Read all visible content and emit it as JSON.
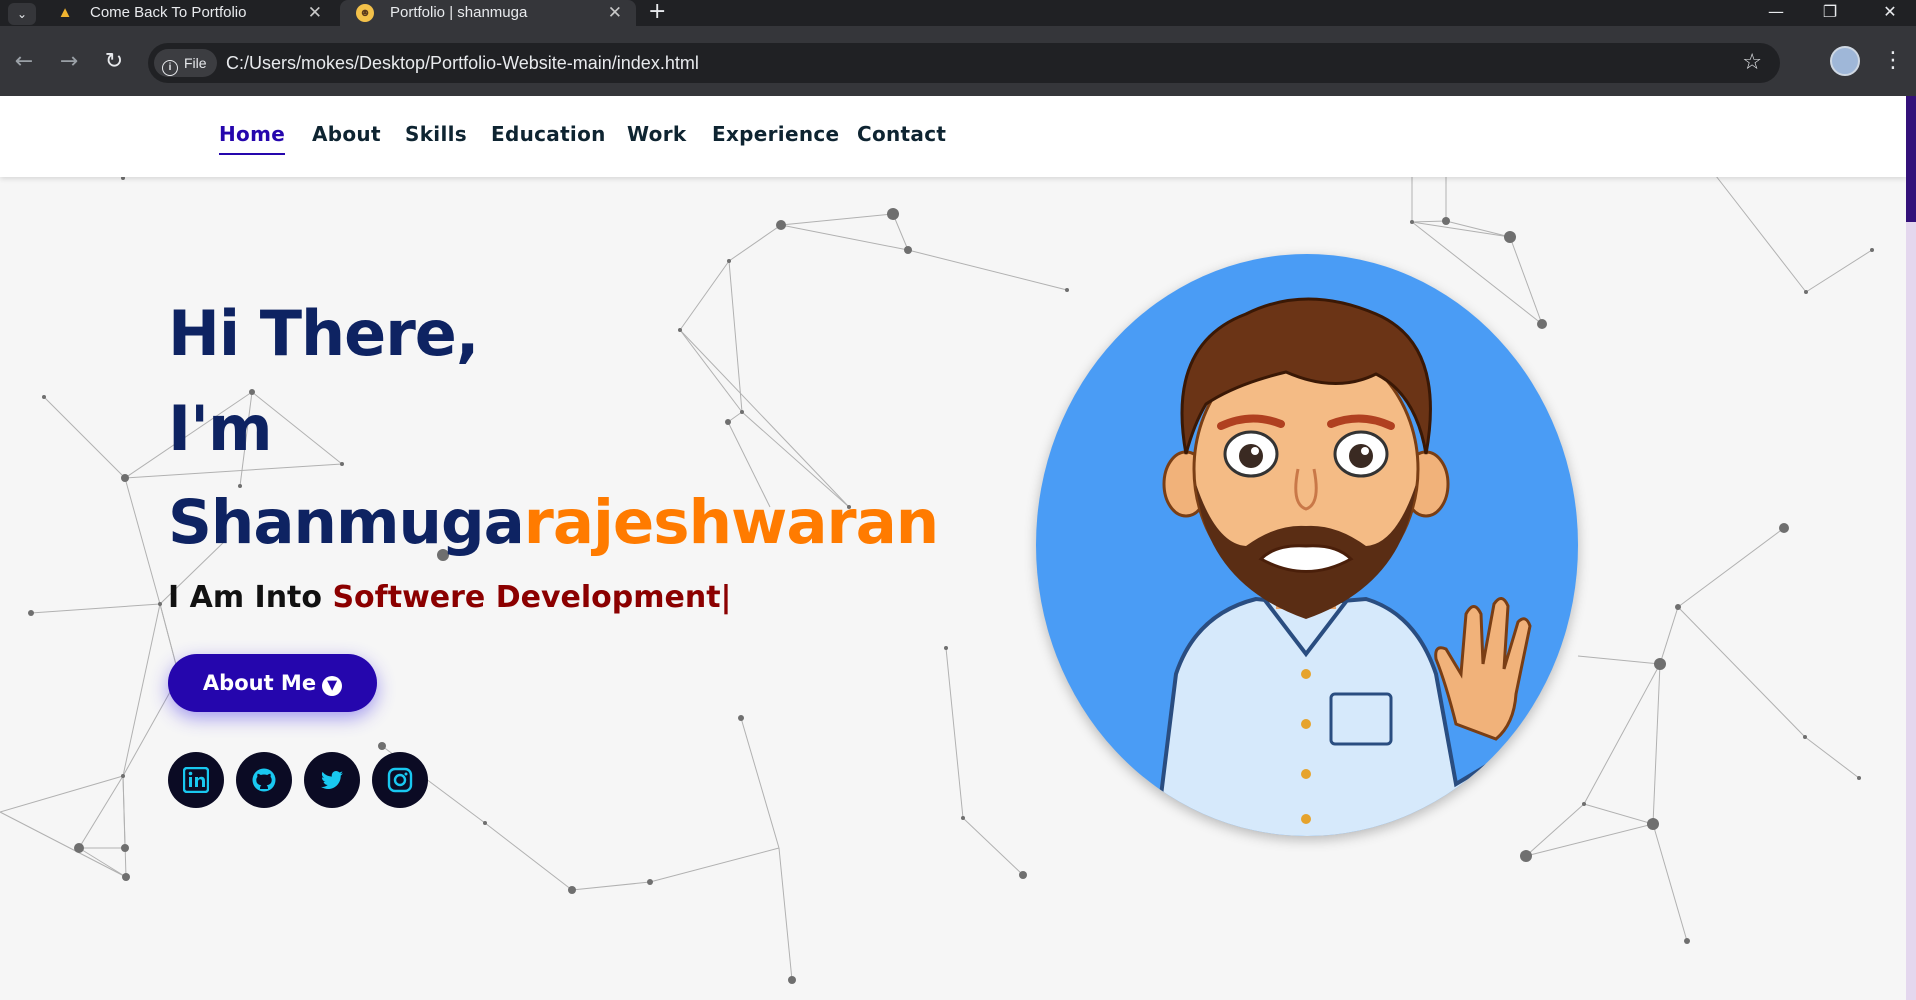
{
  "browser": {
    "tabs": [
      {
        "title": "Come Back To Portfolio",
        "favicon": "praying-hands-icon",
        "active": false
      },
      {
        "title": "Portfolio | shanmuga",
        "favicon": "avatar-favicon-icon",
        "active": true
      }
    ],
    "file_chip": "File",
    "url": "C:/Users/mokes/Desktop/Portfolio-Website-main/index.html"
  },
  "nav": {
    "links": [
      "Home",
      "About",
      "Skills",
      "Education",
      "Work",
      "Experience",
      "Contact"
    ],
    "active": "Home"
  },
  "hero": {
    "line1": "Hi There,",
    "line2": "I'm",
    "name_first": "Shanmuga",
    "name_second": "rajeshwaran",
    "into_prefix": "I Am Into",
    "role": "Softwere Development|",
    "cta_label": "About Me",
    "socials": [
      "linkedin-icon",
      "github-icon",
      "twitter-icon",
      "instagram-icon"
    ]
  },
  "colors": {
    "brand": "#2506ad",
    "heading": "#0e2362",
    "name_accent": "#ff7b00",
    "role_text": "#8b0000",
    "avatar_bg": "#4a9cf5"
  }
}
